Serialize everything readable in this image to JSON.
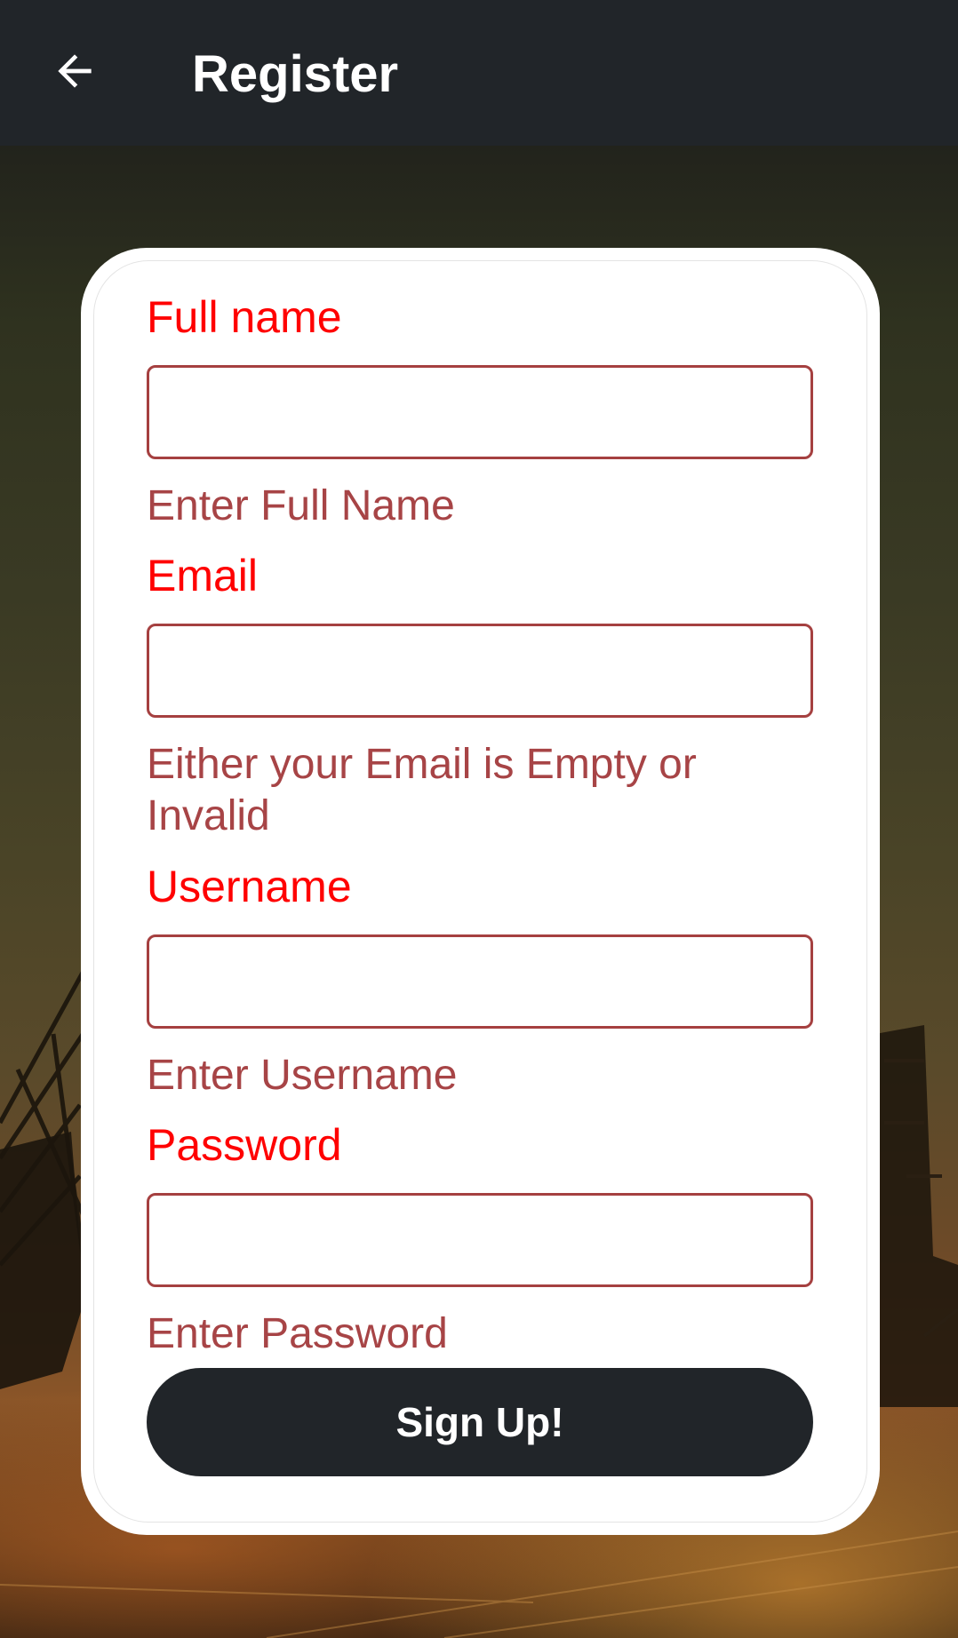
{
  "app_bar": {
    "title": "Register",
    "back_icon": "arrow-left-icon",
    "background_color": "#212529"
  },
  "form": {
    "full_name": {
      "label": "Full name",
      "value": "",
      "helper": "Enter Full Name"
    },
    "email": {
      "label": "Email",
      "value": "",
      "helper": "Either your Email is Empty or Invalid"
    },
    "username": {
      "label": "Username",
      "value": "",
      "helper": "Enter Username"
    },
    "password": {
      "label": "Password",
      "value": "",
      "helper": "Enter Password"
    },
    "submit_label": "Sign Up!"
  },
  "colors": {
    "label": "#ff0000",
    "helper_error": "#a74446",
    "field_border": "#a54040",
    "button": "#212529"
  }
}
